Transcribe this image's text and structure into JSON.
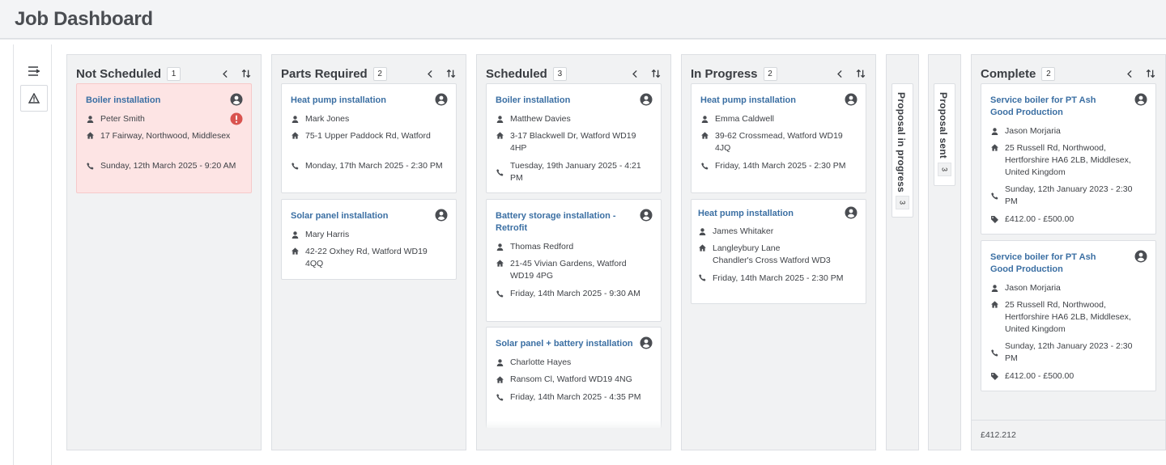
{
  "header": {
    "title": "Job Dashboard"
  },
  "nav": {
    "collapse_icon": "collapse-menu-icon",
    "alert_icon": "warning-icon"
  },
  "columns": [
    {
      "title": "Not Scheduled",
      "count": "1",
      "cards": [
        {
          "title": "Boiler installation",
          "name": "Peter Smith",
          "address": "17 Fairway, Northwood, Middlesex",
          "datetime": "Sunday, 12th March 2025 - 9:20 AM",
          "alert": true
        }
      ]
    },
    {
      "title": "Parts Required",
      "count": "2",
      "cards": [
        {
          "title": "Heat pump installation",
          "name": "Mark Jones",
          "address": "75-1 Upper Paddock Rd, Watford",
          "datetime": "Monday, 17th March 2025 - 2:30 PM"
        },
        {
          "title": "Solar panel installation",
          "name": "Mary Harris",
          "address": "42-22 Oxhey Rd, Watford WD19 4QQ"
        }
      ]
    },
    {
      "title": "Scheduled",
      "count": "3",
      "cards": [
        {
          "title": "Boiler installation",
          "name": "Matthew Davies",
          "address": "3-17 Blackwell Dr, Watford WD19 4HP",
          "datetime": "Tuesday, 19th January 2025 - 4:21 PM"
        },
        {
          "title": "Battery storage installation - Retrofit",
          "name": "Thomas Redford",
          "address": "21-45 Vivian Gardens, Watford WD19 4PG",
          "datetime": "Friday, 14th March 2025 - 9:30 AM"
        },
        {
          "title": "Solar panel + battery installation",
          "name": "Charlotte Hayes",
          "address": "Ransom Cl, Watford WD19 4NG",
          "datetime": "Friday, 14th March 2025 - 4:35 PM"
        }
      ]
    },
    {
      "title": "In Progress",
      "count": "2",
      "cards": [
        {
          "title": "Heat pump installation",
          "name": "Emma Caldwell",
          "address": "39-62 Crossmead, Watford WD19 4JQ",
          "datetime": "Friday, 14th March 2025 - 2:30 PM"
        },
        {
          "title": "Heat pump installation",
          "name": "James Whitaker",
          "address_line1": "Langleybury Lane",
          "address_line2": "Chandler's Cross Watford WD3",
          "datetime": "Friday, 14th March 2025 - 2:30 PM"
        }
      ]
    },
    {
      "title": "Complete",
      "count": "2",
      "cards": [
        {
          "title": "Service boiler for PT Ash Good Production",
          "name": "Jason Morjaria",
          "address": "25 Russell Rd, Northwood, Hertforshire HA6 2LB, Middlesex, United Kingdom",
          "datetime": "Sunday, 12th January 2023 - 2:30 PM",
          "price": "£412.00 - £500.00"
        },
        {
          "title": "Service boiler for PT Ash Good Production",
          "name": "Jason Morjaria",
          "address": "25 Russell Rd, Northwood, Hertforshire HA6 2LB, Middlesex, United Kingdom",
          "datetime": "Sunday, 12th January 2023 - 2:30 PM",
          "price": "£412.00 - £500.00"
        }
      ],
      "footer": "£412.212"
    }
  ],
  "collapsed_columns": [
    {
      "title": "Proposal in progress",
      "count": "3"
    },
    {
      "title": "Proposal sent",
      "count": "3"
    }
  ],
  "colors": {
    "link": "#3b6fa3",
    "alert_bg": "#fde4e4",
    "alert_icon": "#d9534f"
  }
}
